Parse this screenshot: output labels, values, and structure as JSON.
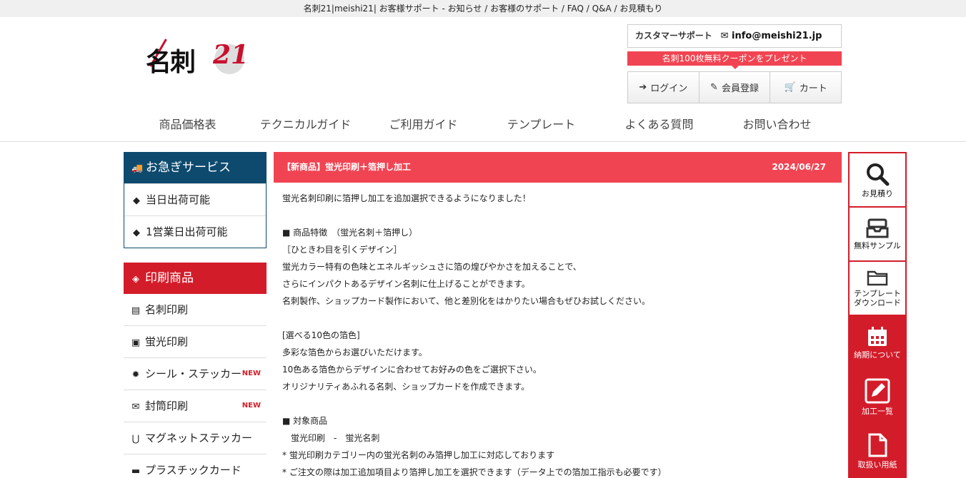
{
  "topbar": {
    "text": "名刺21|meishi21| お客様サポート - お知らせ / お客様のサポート / FAQ / Q&A / お見積もり"
  },
  "logo": {
    "text": "名刺",
    "num": "21"
  },
  "support": {
    "label": "カスタマーサポート",
    "email": "info@meishi21.jp"
  },
  "coupon": {
    "text": "名刺100枚無料クーポンをプレゼント"
  },
  "auth": {
    "login": "ログイン",
    "register": "会員登録",
    "cart": "カート"
  },
  "nav": [
    "商品価格表",
    "テクニカルガイド",
    "ご利用ガイド",
    "テンプレート",
    "よくある質問",
    "お問い合わせ"
  ],
  "urgent": {
    "title": "お急ぎサービス",
    "items": [
      "当日出荷可能",
      "1営業日出荷可能"
    ]
  },
  "print": {
    "title": "印刷商品",
    "items": [
      {
        "label": "名刺印刷",
        "badge": ""
      },
      {
        "label": "蛍光印刷",
        "badge": ""
      },
      {
        "label": "シール・ステッカー",
        "badge": "NEW"
      },
      {
        "label": "封筒印刷",
        "badge": "NEW"
      },
      {
        "label": "マグネットステッカー",
        "badge": ""
      },
      {
        "label": "プラスチックカード",
        "badge": ""
      }
    ]
  },
  "news": {
    "title": "【新商品】蛍光印刷＋箔押し加工",
    "date": "2024/06/27",
    "lines": [
      "蛍光名刺印刷に箔押し加工を追加選択できるようになりました！",
      "",
      "■ 商品特徴　（蛍光名刺＋箔押し）",
      "［ひときわ目を引くデザイン］",
      "蛍光カラー特有の色味とエネルギッシュさに箔の煌びやかさを加えることで、",
      "さらにインパクトあるデザイン名刺に仕上げることができます。",
      "名刺製作、ショップカード製作において、他と差別化をはかりたい場合もぜひお試しください。",
      "",
      "[選べる10色の箔色]",
      "多彩な箔色からお選びいただけます。",
      "10色ある箔色からデザインに合わせてお好みの色をご選択下さい。",
      "オリジナリティあふれる名刺、ショップカードを作成できます。",
      "",
      "■ 対象商品",
      "　蛍光印刷　-　蛍光名刺",
      "* 蛍光印刷カテゴリー内の蛍光名刺のみ箔押し加工に対応しております",
      "* ご注文の際は加工追加項目より箔押し加工を選択できます（データ上での箔加工指示も必要です）"
    ]
  },
  "side": {
    "quote": "お見積り",
    "sample": "無料サンプル",
    "template_l1": "テンプレート",
    "template_l2": "ダウンロード",
    "delivery": "納期について",
    "processing": "加工一覧",
    "paper": "取扱い用紙"
  },
  "colors": {
    "brand_red": "#d31c2a",
    "accent_pink": "#f14452",
    "navy": "#0d4a6e"
  }
}
